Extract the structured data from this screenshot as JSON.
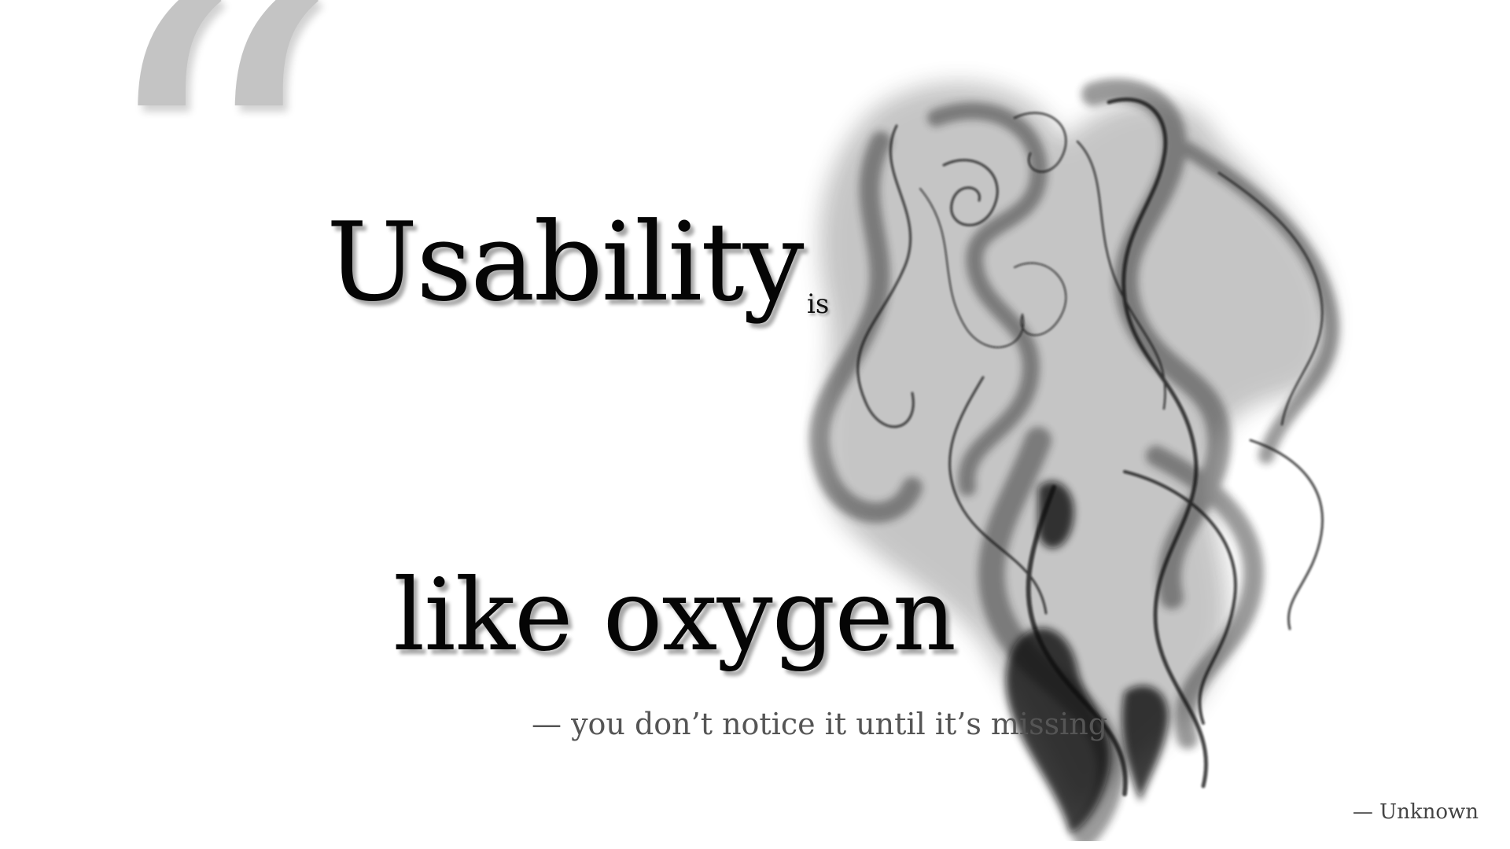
{
  "slide": {
    "quote_mark": "“",
    "word_usability": "Usability",
    "word_is": "is",
    "phrase_oxygen": "like oxygen",
    "tagline": "— you don’t notice it until it’s missing",
    "attribution": "— Unknown"
  },
  "colors": {
    "background": "#ffffff",
    "quote_mark": "#c4c4c4",
    "headline": "#050505",
    "tagline": "#555555",
    "smoke": "#1a1a1a"
  },
  "decorations": {
    "smoke_icon": "smoke-plume"
  }
}
